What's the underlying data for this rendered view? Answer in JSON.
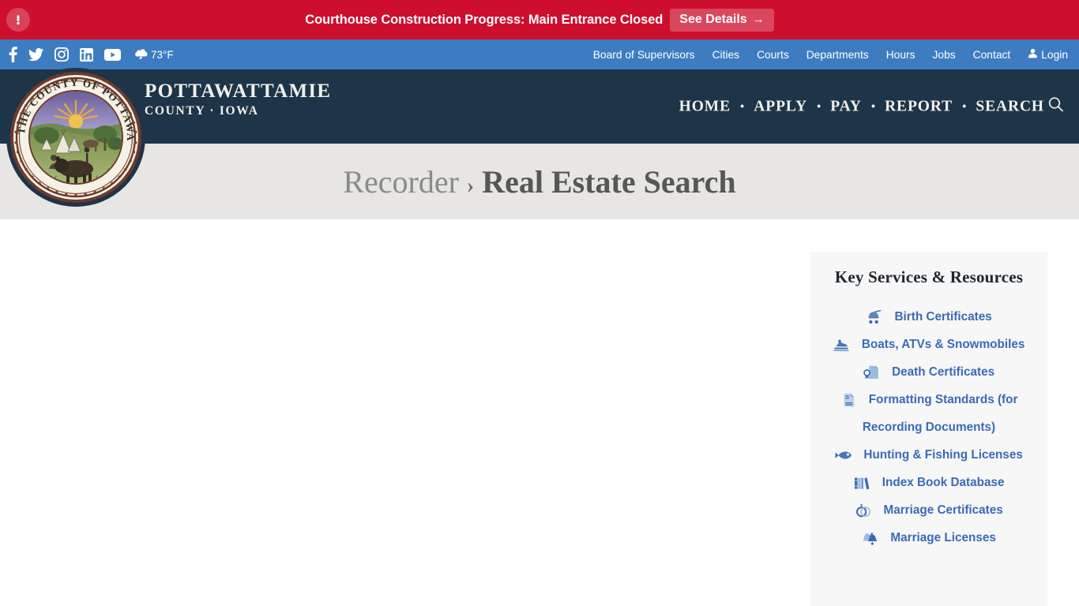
{
  "alert": {
    "icon": "exclamation-circle-icon",
    "message": "Courthouse Construction Progress: Main Entrance Closed",
    "button_label": "See Details",
    "button_arrow": "→",
    "background_color": "#ce0e2d"
  },
  "utility_bar": {
    "background_color": "#3e7cc2",
    "social": [
      {
        "name": "facebook-icon",
        "label": "Facebook"
      },
      {
        "name": "twitter-icon",
        "label": "Twitter"
      },
      {
        "name": "instagram-icon",
        "label": "Instagram"
      },
      {
        "name": "linkedin-icon",
        "label": "LinkedIn"
      },
      {
        "name": "youtube-icon",
        "label": "YouTube"
      }
    ],
    "weather": {
      "icon": "rain-cloud-icon",
      "temperature": "73°F"
    },
    "links": [
      {
        "label": "Board of Supervisors"
      },
      {
        "label": "Cities"
      },
      {
        "label": "Courts"
      },
      {
        "label": "Departments"
      },
      {
        "label": "Hours"
      },
      {
        "label": "Jobs"
      },
      {
        "label": "Contact"
      }
    ],
    "login": {
      "label": "Login",
      "icon": "user-icon"
    }
  },
  "header": {
    "background_color": "#1e3448",
    "seal_alt": "Seal of the County of Pottawattamie Iowa",
    "brand_main": "POTTAWATTAMIE",
    "brand_sub": "COUNTY · IOWA",
    "nav": [
      {
        "label": "HOME"
      },
      {
        "label": "APPLY"
      },
      {
        "label": "PAY"
      },
      {
        "label": "REPORT"
      },
      {
        "label": "SEARCH"
      }
    ],
    "nav_separator": "•",
    "search_icon": "magnifier-icon"
  },
  "page_title": {
    "parent": "Recorder",
    "separator": "›",
    "current": "Real Estate Search",
    "band_color": "#e7e6e4"
  },
  "sidebar": {
    "title": "Key Services & Resources",
    "link_color": "#3a6bb5",
    "background_color": "#f7f7f7",
    "items": [
      {
        "label": "Birth Certificates",
        "icon": "stroller-icon"
      },
      {
        "label": "Boats, ATVs & Snowmobiles",
        "icon": "snowmobile-icon"
      },
      {
        "label": "Death Certificates",
        "icon": "certificate-seal-icon"
      },
      {
        "label": "Formatting Standards (for Recording Documents)",
        "icon": "document-icon"
      },
      {
        "label": "Hunting & Fishing Licenses",
        "icon": "fish-icon"
      },
      {
        "label": "Index Book Database",
        "icon": "books-icon"
      },
      {
        "label": "Marriage Certificates",
        "icon": "rings-icon"
      },
      {
        "label": "Marriage Licenses",
        "icon": "bells-icon"
      }
    ]
  }
}
